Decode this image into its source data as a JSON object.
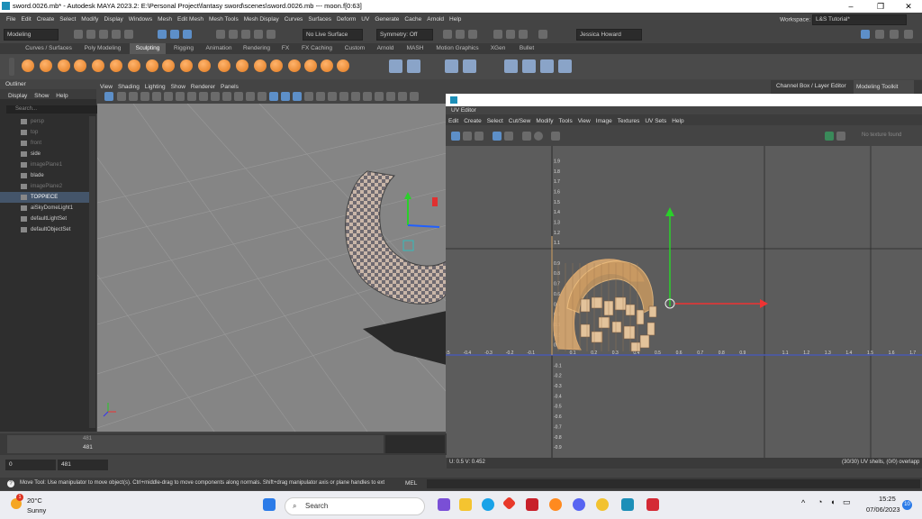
{
  "window": {
    "title": "sword.0026.mb* - Autodesk MAYA 2023.2: E:\\Personal Project\\fantasy sword\\scenes\\sword.0026.mb  ---  moon.f[0:63]",
    "minimize": "–",
    "maximize": "❐",
    "close": "✕"
  },
  "menubar": {
    "items": [
      "File",
      "Edit",
      "Create",
      "Select",
      "Modify",
      "Display",
      "Windows",
      "Mesh",
      "Edit Mesh",
      "Mesh Tools",
      "Mesh Display",
      "Curves",
      "Surfaces",
      "Deform",
      "UV",
      "Generate",
      "Cache",
      "Arnold",
      "Help"
    ],
    "workspace_label": "Workspace:",
    "workspace_value": "L&S Tutorial*"
  },
  "statusline": {
    "mode": "Modeling",
    "live_surface": "No Live Surface",
    "symmetry": "Symmetry: Off",
    "user": "Jessica Howard"
  },
  "shelf": {
    "tabs": [
      "Curves / Surfaces",
      "Poly Modeling",
      "Sculpting",
      "Rigging",
      "Animation",
      "Rendering",
      "FX",
      "FX Caching",
      "Custom",
      "Arnold",
      "MASH",
      "Motion Graphics",
      "XGen",
      "Bullet"
    ],
    "active_tab": "Sculpting"
  },
  "outliner": {
    "title": "Outliner",
    "menu": [
      "Display",
      "Show",
      "Help"
    ],
    "search_placeholder": "Search...",
    "items": [
      {
        "label": "persp",
        "dim": true
      },
      {
        "label": "top",
        "dim": true
      },
      {
        "label": "front",
        "dim": true
      },
      {
        "label": "side",
        "dim": false
      },
      {
        "label": "imagePlane1",
        "dim": true
      },
      {
        "label": "blade",
        "dim": false
      },
      {
        "label": "imagePlane2",
        "dim": true
      },
      {
        "label": "TOPPIECE",
        "dim": false,
        "selected": true
      },
      {
        "label": "aiSkyDomeLight1",
        "dim": false
      },
      {
        "label": "defaultLightSet",
        "dim": false
      },
      {
        "label": "defaultObjectSet",
        "dim": false
      }
    ]
  },
  "viewport": {
    "menu": [
      "View",
      "Shading",
      "Lighting",
      "Show",
      "Renderer",
      "Panels"
    ]
  },
  "right_panel": {
    "tabs": [
      "Channel Box / Layer Editor",
      "Modeling Toolkit"
    ]
  },
  "uv_editor": {
    "title": "UV Editor",
    "menu": [
      "Edit",
      "Create",
      "Select",
      "Cut/Sew",
      "Modify",
      "Tools",
      "View",
      "Image",
      "Textures",
      "UV Sets",
      "Help"
    ],
    "texture_status": "No texture found",
    "u_ticks": [
      "-1",
      "-0.9",
      "-0.8",
      "-0.7",
      "-0.6",
      "-0.5",
      "-0.4",
      "-0.3",
      "-0.2",
      "-0.1",
      "0.1",
      "0.2",
      "0.3",
      "0.4",
      "0.5",
      "0.6",
      "0.7",
      "0.8",
      "0.9",
      "1.1",
      "1.2",
      "1.3",
      "1.4",
      "1.5",
      "1.6",
      "1.7",
      "1.8",
      "1.9",
      "2.1",
      "2.2",
      "2.3",
      "2.4",
      "2.5",
      "2.6",
      "2.7",
      "2.8",
      "2.9",
      "3.1",
      "3.2",
      "3.3",
      "3.4"
    ],
    "v_ticks": [
      "1.9",
      "1.8",
      "1.7",
      "1.6",
      "1.5",
      "1.4",
      "1.3",
      "1.2",
      "1.1",
      "0.9",
      "0.8",
      "0.7",
      "0.6",
      "0.5",
      "0.4",
      "0.3",
      "0.2",
      "0.1",
      "-0.1",
      "-0.2",
      "-0.3",
      "-0.4",
      "-0.5",
      "-0.6",
      "-0.7",
      "-0.8",
      "-0.9"
    ],
    "coords": "U: 0.5 V: 0.452",
    "shells": "(30/30) UV shells, (0/0) overlapp"
  },
  "timeline": {
    "current_frame_top": "481",
    "current_frame": "481",
    "range_start": "0",
    "range_current": "481"
  },
  "helpline": {
    "text": "Move Tool: Use manipulator to move object(s). Ctrl+middle-drag to move components along normals. Shift+drag manipulator axis or plane handles to ext",
    "mel_label": "MEL"
  },
  "taskbar": {
    "weather_temp": "20°C",
    "weather_desc": "Sunny",
    "search_label": "Search",
    "time": "15:25",
    "date": "07/06/2023",
    "notification_count": "10"
  }
}
